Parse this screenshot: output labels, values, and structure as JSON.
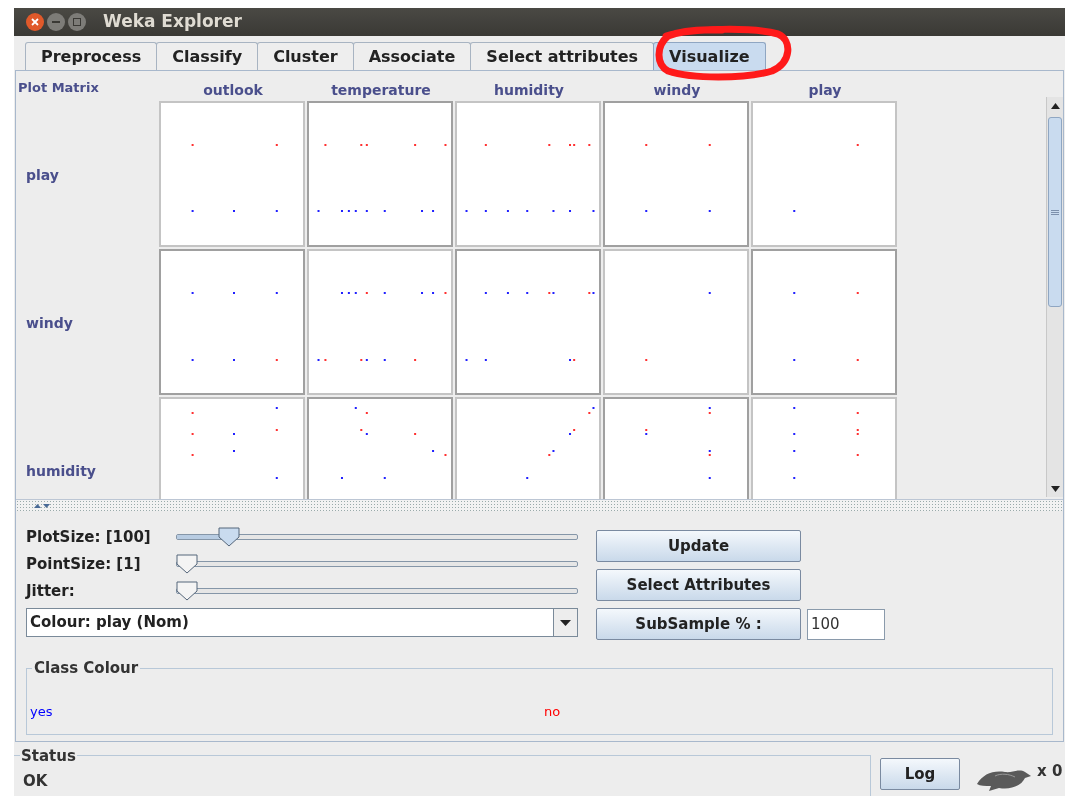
{
  "window": {
    "title": "Weka Explorer"
  },
  "tabs": [
    {
      "label": "Preprocess",
      "selected": false
    },
    {
      "label": "Classify",
      "selected": false
    },
    {
      "label": "Cluster",
      "selected": false
    },
    {
      "label": "Associate",
      "selected": false
    },
    {
      "label": "Select attributes",
      "selected": false
    },
    {
      "label": "Visualize",
      "selected": true
    }
  ],
  "plot_matrix": {
    "title": "Plot Matrix",
    "columns": [
      "outlook",
      "temperature",
      "humidity",
      "windy",
      "play"
    ],
    "rows": [
      "play",
      "windy",
      "humidity"
    ]
  },
  "sliders": [
    {
      "label": "PlotSize: [100]",
      "level": 0.11
    },
    {
      "label": "PointSize: [1]",
      "level": 0
    },
    {
      "label": "Jitter:",
      "level": 0
    }
  ],
  "colour_dropdown": {
    "value": "Colour: play (Nom)"
  },
  "buttons": [
    "Update",
    "Select Attributes"
  ],
  "subsample": {
    "label": "SubSample % :",
    "value": "100"
  },
  "class_colour": {
    "title": "Class Colour",
    "classes": [
      {
        "label": "yes",
        "color": "#0000ff"
      },
      {
        "label": "no",
        "color": "#ff0000"
      }
    ]
  },
  "status": {
    "title": "Status",
    "message": "OK"
  },
  "log_button": "Log",
  "task_count": "x 0"
}
